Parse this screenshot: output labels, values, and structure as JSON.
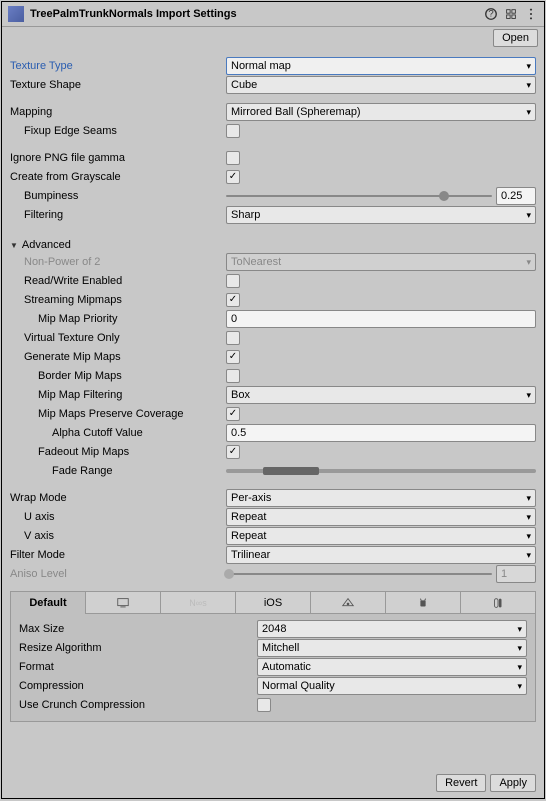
{
  "header": {
    "title": "TreePalmTrunkNormals Import Settings",
    "open_label": "Open"
  },
  "fields": {
    "texture_type": {
      "label": "Texture Type",
      "value": "Normal map"
    },
    "texture_shape": {
      "label": "Texture Shape",
      "value": "Cube"
    },
    "mapping": {
      "label": "Mapping",
      "value": "Mirrored Ball (Spheremap)"
    },
    "fixup_edge_seams": {
      "label": "Fixup Edge Seams"
    },
    "ignore_png_gamma": {
      "label": "Ignore PNG file gamma"
    },
    "create_from_grayscale": {
      "label": "Create from Grayscale"
    },
    "bumpiness": {
      "label": "Bumpiness",
      "value": "0.25"
    },
    "filtering": {
      "label": "Filtering",
      "value": "Sharp"
    },
    "advanced": {
      "label": "Advanced"
    },
    "non_power_of_2": {
      "label": "Non-Power of 2",
      "value": "ToNearest"
    },
    "read_write": {
      "label": "Read/Write Enabled"
    },
    "streaming_mipmaps": {
      "label": "Streaming Mipmaps"
    },
    "mipmap_priority": {
      "label": "Mip Map Priority",
      "value": "0"
    },
    "virtual_texture_only": {
      "label": "Virtual Texture Only"
    },
    "generate_mipmaps": {
      "label": "Generate Mip Maps"
    },
    "border_mipmaps": {
      "label": "Border Mip Maps"
    },
    "mipmap_filtering": {
      "label": "Mip Map Filtering",
      "value": "Box"
    },
    "mipmaps_preserve_coverage": {
      "label": "Mip Maps Preserve Coverage"
    },
    "alpha_cutoff": {
      "label": "Alpha Cutoff Value",
      "value": "0.5"
    },
    "fadeout_mipmaps": {
      "label": "Fadeout Mip Maps"
    },
    "fade_range": {
      "label": "Fade Range"
    },
    "wrap_mode": {
      "label": "Wrap Mode",
      "value": "Per-axis"
    },
    "u_axis": {
      "label": "U axis",
      "value": "Repeat"
    },
    "v_axis": {
      "label": "V axis",
      "value": "Repeat"
    },
    "filter_mode": {
      "label": "Filter Mode",
      "value": "Trilinear"
    },
    "aniso_level": {
      "label": "Aniso Level",
      "value": "1"
    }
  },
  "platform": {
    "tabs": {
      "default": "Default",
      "pc": "",
      "nios": "",
      "ios": "iOS",
      "web": "",
      "android": "",
      "switch": ""
    },
    "max_size": {
      "label": "Max Size",
      "value": "2048"
    },
    "resize_algorithm": {
      "label": "Resize Algorithm",
      "value": "Mitchell"
    },
    "format": {
      "label": "Format",
      "value": "Automatic"
    },
    "compression": {
      "label": "Compression",
      "value": "Normal Quality"
    },
    "use_crunch": {
      "label": "Use Crunch Compression"
    }
  },
  "footer": {
    "revert": "Revert",
    "apply": "Apply"
  }
}
